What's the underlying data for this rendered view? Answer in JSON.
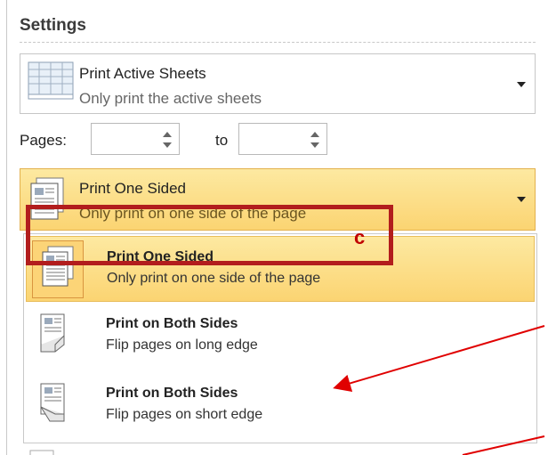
{
  "settings": {
    "title": "Settings"
  },
  "print_what": {
    "title": "Print Active Sheets",
    "subtitle": "Only print the active sheets",
    "icon": "active-sheets-icon"
  },
  "pages": {
    "label": "Pages:",
    "to_label": "to",
    "from_value": "",
    "to_value": ""
  },
  "sided": {
    "title": "Print One Sided",
    "subtitle": "Only print on one side of the page",
    "icon": "one-sided-page-icon",
    "options": [
      {
        "title": "Print One Sided",
        "subtitle": "Only print on one side of the page",
        "icon": "one-sided-page-icon",
        "selected": true
      },
      {
        "title": "Print on Both Sides",
        "subtitle": "Flip pages on long edge",
        "icon": "flip-long-edge-icon",
        "selected": false
      },
      {
        "title": "Print on Both Sides",
        "subtitle": "Flip pages on short edge",
        "icon": "flip-short-edge-icon",
        "selected": false
      }
    ]
  },
  "annotation": {
    "letter": "c",
    "color": "#c00000"
  },
  "colors": {
    "highlight_top": "#fde9a1",
    "highlight_bottom": "#fbd472",
    "highlight_border": "#e3b14e",
    "annotation_red": "#b21d1d"
  }
}
